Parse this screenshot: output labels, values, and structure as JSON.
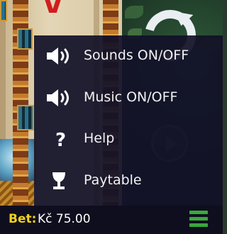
{
  "menu": {
    "items": [
      {
        "label": "Sounds ON/OFF",
        "icon": "speaker-icon"
      },
      {
        "label": "Music ON/OFF",
        "icon": "speaker-icon"
      },
      {
        "label": "Help",
        "icon": "question-mark-icon"
      },
      {
        "label": "Paytable",
        "icon": "trophy-cup-icon"
      }
    ]
  },
  "status_bar": {
    "bet_label": "Bet:",
    "bet_value": "Kč 75.00",
    "menu_icon": "hamburger-menu-icon"
  },
  "game": {
    "spin_icon": "spin-refresh-icon",
    "autospin_icon": "autospin-icon"
  },
  "colors": {
    "menu_bg": "#121128",
    "bet_label": "#f2d21a",
    "hamburger": "#3aa83c",
    "statusbar_bg": "#0f0e1e"
  }
}
